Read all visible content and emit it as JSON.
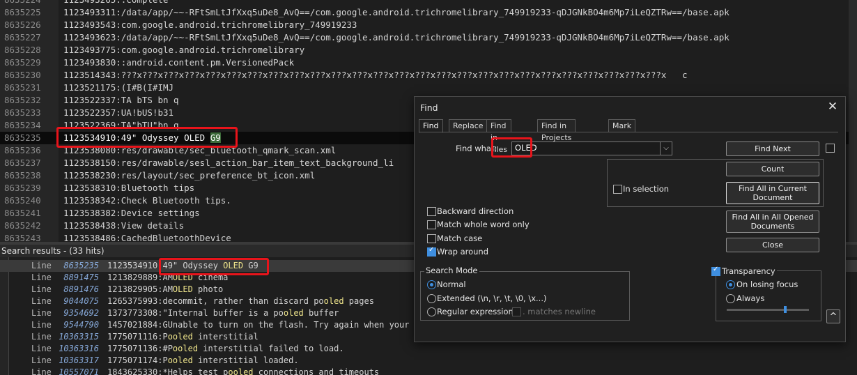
{
  "editor": {
    "lines": [
      {
        "num": "8635224",
        "text": "1123493265::complete"
      },
      {
        "num": "8635225",
        "text": "1123493311:/data/app/~~-RFtSmLtJfXxq5uDe8_AvQ==/com.google.android.trichromelibrary_749919233-qDJGNkBO4m6Mp7iLeQZTRw==/base.apk"
      },
      {
        "num": "8635226",
        "text": "1123493543:com.google.android.trichromelibrary_749919233"
      },
      {
        "num": "8635227",
        "text": "1123493623:/data/app/~~-RFtSmLtJfXxq5uDe8_AvQ==/com.google.android.trichromelibrary_749919233-qDJGNkBO4m6Mp7iLeQZTRw==/base.apk"
      },
      {
        "num": "8635228",
        "text": "1123493775:com.google.android.trichromelibrary"
      },
      {
        "num": "8635229",
        "text": "1123493830::android.content.pm.VersionedPack"
      },
      {
        "num": "8635230",
        "text": "1123514343:???x???x???x???x???x???x???x???x???x???x???x???x???x???x???x???x???x???x???x???x???x???x???x???x???x???x   c"
      },
      {
        "num": "8635231",
        "text": "1123521175:(I#B(I#IMJ"
      },
      {
        "num": "8635232",
        "text": "1123522337:TA bTS bn q"
      },
      {
        "num": "8635233",
        "text": "1123522357:UA!bUS!b31"
      },
      {
        "num": "8635234",
        "text": "1123522369:TA\"bTU\"bn q"
      },
      {
        "num": "8635235",
        "text": "1123534910:49\" Odyssey OLED ",
        "highlight": "G9"
      },
      {
        "num": "8635236",
        "text": "1123538080:res/drawable/sec_bluetooth_qmark_scan.xml"
      },
      {
        "num": "8635237",
        "text": "1123538150:res/drawable/sesl_action_bar_item_text_background_li"
      },
      {
        "num": "8635238",
        "text": "1123538230:res/layout/sec_preference_bt_icon.xml"
      },
      {
        "num": "8635239",
        "text": "1123538310:Bluetooth tips"
      },
      {
        "num": "8635240",
        "text": "1123538342:Check Bluetooth tips."
      },
      {
        "num": "8635241",
        "text": "1123538382:Device settings"
      },
      {
        "num": "8635242",
        "text": "1123538438:View details"
      },
      {
        "num": "8635243",
        "text": "1123538486:CachedBluetoothDevice"
      }
    ]
  },
  "search_results": {
    "header": "Search results - (33 hits)",
    "rows": [
      {
        "label": "Line",
        "num": "8635235",
        "pre": "1123534910:49\" Odyssey ",
        "hit": "OLED",
        "post": " G9"
      },
      {
        "label": "Line",
        "num": "8891475",
        "pre": "1213829889:AM",
        "hit": "OLED",
        "post": " cinema"
      },
      {
        "label": "Line",
        "num": "8891476",
        "pre": "1213829905:AM",
        "hit": "OLED",
        "post": " photo"
      },
      {
        "label": "Line",
        "num": "9044075",
        "pre": "1265375993:decommit, rather than discard po",
        "hit": "oled",
        "post": " pages"
      },
      {
        "label": "Line",
        "num": "9354692",
        "pre": "1373773308:\"Internal buffer is a po",
        "hit": "oled",
        "post": " buffer"
      },
      {
        "label": "Line",
        "num": "9544790",
        "pre": "1457021884:GUnable to turn on the flash. Try again when your",
        "hit": "",
        "post": ""
      },
      {
        "label": "Line",
        "num": "10363315",
        "pre": "1775071116:P",
        "hit": "ooled",
        "post": " interstitial"
      },
      {
        "label": "Line",
        "num": "10363316",
        "pre": "1775071136:#P",
        "hit": "ooled",
        "post": " interstitial failed to load."
      },
      {
        "label": "Line",
        "num": "10363317",
        "pre": "1775071174:P",
        "hit": "ooled",
        "post": " interstitial loaded."
      },
      {
        "label": "Line",
        "num": "10557071",
        "pre": "1843625330:*Helps test p",
        "hit": "ooled",
        "post": " connections and timeouts"
      }
    ]
  },
  "find_dialog": {
    "title": "Find",
    "close_glyph": "✕",
    "tabs": [
      "Find",
      "Replace",
      "Find in Files",
      "Find in Projects",
      "Mark"
    ],
    "find_what_label": "Find what:",
    "find_what_value": "OLED",
    "buttons": {
      "find_next": "Find Next",
      "count": "Count",
      "find_all_current": "Find All in Current Document",
      "find_all_opened": "Find All in All Opened Documents",
      "close": "Close"
    },
    "in_selection": "In selection",
    "options": {
      "backward": "Backward direction",
      "whole_word": "Match whole word only",
      "match_case": "Match case",
      "wrap_around": "Wrap around"
    },
    "search_mode": {
      "title": "Search Mode",
      "normal": "Normal",
      "extended": "Extended (\\n, \\r, \\t, \\0, \\x...)",
      "regex": "Regular expression",
      "matches_newline": ". matches newline"
    },
    "transparency": {
      "title": "Transparency",
      "on_losing_focus": "On losing focus",
      "always": "Always",
      "level": 0.72
    },
    "collapse_glyph": "^"
  }
}
